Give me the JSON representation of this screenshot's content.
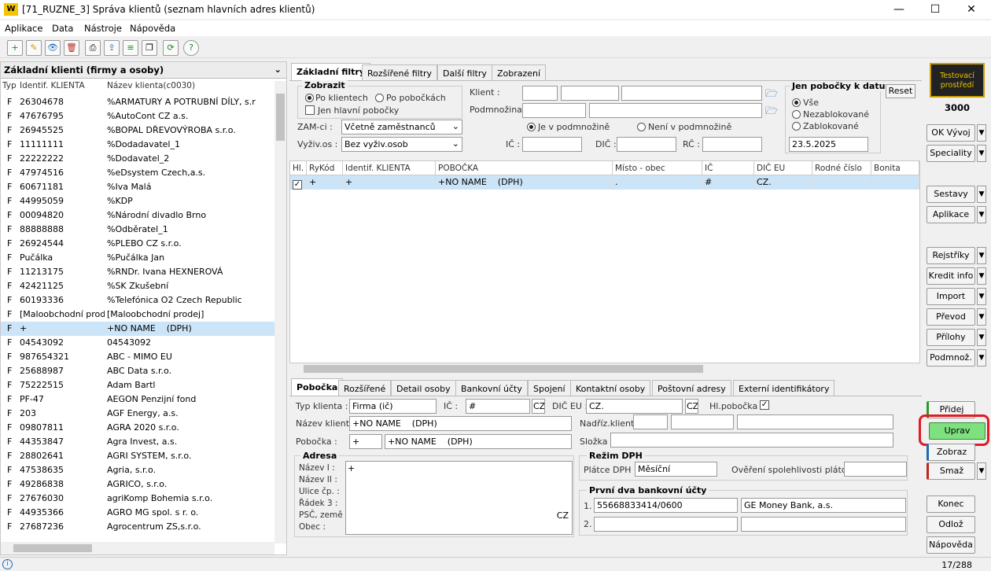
{
  "window": {
    "title": "[71_RUZNE_3] Správa klientů (seznam hlavních adres klientů)",
    "logo": "W",
    "min": "—",
    "max": "☐",
    "close": "✕"
  },
  "menu": [
    "Aplikace",
    "Data",
    "Nástroje",
    "Nápověda"
  ],
  "toolbar": {
    "icons": [
      "add-icon",
      "edit-icon",
      "view-icon",
      "delete-icon",
      "print-icon",
      "export-icon",
      "list-icon",
      "copy-icon",
      "refresh-icon",
      "help-icon"
    ],
    "glyphs": [
      "+",
      "✎",
      "👁",
      "🗑",
      "⎙",
      "⇪",
      "≡",
      "❐",
      "⟳",
      "?"
    ]
  },
  "left": {
    "header": "Základní klienti (firmy a osoby)",
    "cols": [
      "Typ",
      "Identif. KLIENTA",
      "Název klienta(c0030)"
    ],
    "rows": [
      [
        "F",
        "26304678",
        "%ARMATURY A POTRUBNÍ DÍLY, s.r"
      ],
      [
        "F",
        "47676795",
        "%AutoCont CZ a.s."
      ],
      [
        "F",
        "26945525",
        "%BOPAL DŘEVOVÝROBA s.r.o."
      ],
      [
        "F",
        "11111111",
        "%Dodadavatel_1"
      ],
      [
        "F",
        "22222222",
        "%Dodavatel_2"
      ],
      [
        "F",
        "47974516",
        "%eDsystem Czech,a.s."
      ],
      [
        "F",
        "60671181",
        "%Iva Malá"
      ],
      [
        "F",
        "44995059",
        "%KDP"
      ],
      [
        "F",
        "00094820",
        "%Národní divadlo Brno"
      ],
      [
        "F",
        "88888888",
        "%Odběratel_1"
      ],
      [
        "F",
        "26924544",
        "%PLEBO CZ s.r.o."
      ],
      [
        "F",
        "Pučálka",
        "%Pučálka Jan"
      ],
      [
        "F",
        "11213175",
        "%RNDr. Ivana HEXNEROVÁ"
      ],
      [
        "F",
        "42421125",
        "%SK Zkušební"
      ],
      [
        "F",
        "60193336",
        "%Telefónica O2 Czech Republic"
      ],
      [
        "F",
        "[Maloobchodní prodej]",
        "[Maloobchodní prodej]"
      ],
      [
        "F",
        "+",
        "+NO NAME    (DPH)"
      ],
      [
        "F",
        "04543092",
        "04543092"
      ],
      [
        "F",
        "987654321",
        "ABC - MIMO EU"
      ],
      [
        "F",
        "25688987",
        "ABC Data s.r.o."
      ],
      [
        "F",
        "75222515",
        "Adam Bartl"
      ],
      [
        "F",
        "PF-47",
        "AEGON Penzijní fond"
      ],
      [
        "F",
        "203",
        "AGF Energy, a.s."
      ],
      [
        "F",
        "09807811",
        "AGRA 2020 s.r.o."
      ],
      [
        "F",
        "44353847",
        "Agra Invest, a.s."
      ],
      [
        "F",
        "28802641",
        "AGRI SYSTEM, s.r.o."
      ],
      [
        "F",
        "47538635",
        "Agria, s.r.o."
      ],
      [
        "F",
        "49286838",
        "AGRICO, s.r.o."
      ],
      [
        "F",
        "27676030",
        "agriKomp Bohemia s.r.o."
      ],
      [
        "F",
        "44935366",
        "AGRO MG spol. s r. o."
      ],
      [
        "F",
        "27687236",
        "Agrocentrum ZS,s.r.o."
      ]
    ],
    "selected_index": 16
  },
  "filters": {
    "tabs": [
      "Základní filtry",
      "Rozšířené filtry",
      "Další filtry",
      "Zobrazení"
    ],
    "zobrazit": "Zobrazit",
    "po_klientech": "Po klientech",
    "po_pobockach": "Po pobočkách",
    "jen_hlavni": "Jen hlavní pobočky",
    "zam_label": "ZAM-ci :",
    "zam_value": "Včetně zaměstnanců",
    "vyziv_label": "Vyživ.os :",
    "vyziv_value": "Bez vyživ.osob",
    "klient_label": "Klient :",
    "podmnozina_label": "Podmnožina :",
    "je_v": "Je v podmnožině",
    "neni_v": "Není v podmnožině",
    "ic": "IČ :",
    "dic": "DIČ :",
    "rc": "RČ :",
    "jen_pob": "Jen pobočky k datu",
    "vse": "Vše",
    "nezablok": "Nezablokované",
    "zablok": "Zablokované",
    "datum": "23.5.2025",
    "reset": "Reset"
  },
  "grid": {
    "cols": [
      "Hl.",
      "RyKód",
      "Identif. KLIENTA",
      "POBOČKA",
      "Místo - obec",
      "IČ",
      "DIČ EU",
      "Rodné číslo",
      "Bonita"
    ],
    "row": [
      "✓",
      "+",
      "+",
      "+NO NAME    (DPH)",
      ".",
      "#",
      "CZ.",
      "",
      ""
    ]
  },
  "detail": {
    "tabs": [
      "Pobočka",
      "Rozšířené",
      "Detail osoby",
      "Bankovní účty",
      "Spojení",
      "Kontaktní osoby",
      "Poštovní adresy",
      "Externí identifikátory"
    ],
    "typ_label": "Typ klienta :",
    "typ_value": "Firma (ič)",
    "ic_label": "IČ :",
    "ic_value": "#",
    "cz1": "CZ",
    "dic_label": "DIČ EU :",
    "dic_value": "CZ.",
    "cz2": "CZ",
    "hlpob_label": "Hl.pobočka :",
    "nazev_label": "Název klienta:",
    "nazev_value": "+NO NAME    (DPH)",
    "nadriz_label": "Nadříz.klient :",
    "pobocka_label": "Pobočka :",
    "pobocka_code": "+",
    "pobocka_value": "+NO NAME    (DPH)",
    "slozka_label": "Složka :",
    "adresa": "Adresa",
    "addr_labels": [
      "Název I :",
      "Název II :",
      "Ulice čp. :",
      "Řádek 3 :",
      "PSČ, země :",
      "Obec :"
    ],
    "addr_plus": "+",
    "addr_cz": "CZ",
    "rezim": "Režim DPH",
    "platce_label": "Plátce DPH :",
    "platce_value": "Měsíční",
    "overeni": "Ověření spolehlivosti plátce :",
    "ucty": "První dva bankovní účty",
    "u1": "1.",
    "u1_num": "55668833414/0600",
    "u1_bank": "GE Money Bank, a.s.",
    "u2": "2."
  },
  "side": {
    "badge": "Testovací prostředí",
    "number": "3000",
    "buttons": [
      "OK Vývoj",
      "Speciality",
      "Sestavy",
      "Aplikace",
      "Rejstříky",
      "Kredit info",
      "Import",
      "Převod",
      "Přílohy",
      "Podmnož.",
      "Přidej",
      "Uprav",
      "Zobraz",
      "Smaž",
      "Konec",
      "Odlož",
      "Nápověda"
    ]
  },
  "status": {
    "info": "i",
    "count": "17/288"
  },
  "colors": {
    "highlight": "#cce4f7",
    "upravBorder": "#e01b24",
    "upravBg": "#7ee07e"
  }
}
